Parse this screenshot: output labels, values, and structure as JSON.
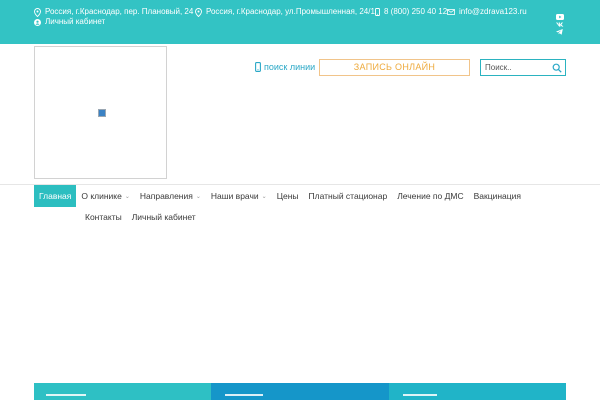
{
  "colors": {
    "topbar": "#33c3c4",
    "accent": "#2cbec0",
    "booking": "#eeaa3c",
    "tile_1": "#2ec0c4",
    "tile_2": "#1596c9",
    "tile_3": "#20b4c8"
  },
  "topbar": {
    "address_1": "Россия, г.Краснодар, пер. Плановый, 24",
    "address_2": "Россия, г.Краснодар, ул.Промышленная, 24/1",
    "phone": "8 (800) 250 40 12",
    "email": "info@zdrava123.ru",
    "cabinet": "Личный кабинет",
    "icons": [
      "location-icon",
      "location-icon",
      "phone-icon",
      "mail-icon",
      "user-icon",
      "youtube-icon",
      "vk-icon",
      "telegram-icon"
    ]
  },
  "header": {
    "hotline": "поиск линии",
    "booking_button": "ЗАПИСЬ ОНЛАЙН",
    "search_placeholder": "Поиск.."
  },
  "nav": {
    "row1": [
      {
        "label": "Главная",
        "active": true,
        "dropdown": false
      },
      {
        "label": "О клинике",
        "active": false,
        "dropdown": true
      },
      {
        "label": "Направления",
        "active": false,
        "dropdown": true
      },
      {
        "label": "Наши врачи",
        "active": false,
        "dropdown": true
      },
      {
        "label": "Цены",
        "active": false,
        "dropdown": false
      },
      {
        "label": "Платный стационар",
        "active": false,
        "dropdown": false
      },
      {
        "label": "Лечение по ДМС",
        "active": false,
        "dropdown": false
      },
      {
        "label": "Вакцинация",
        "active": false,
        "dropdown": false
      }
    ],
    "row2": [
      {
        "label": "Контакты",
        "active": false,
        "dropdown": false
      },
      {
        "label": "Личный кабинет",
        "active": false,
        "dropdown": false
      }
    ],
    "chevron": "⌄"
  }
}
